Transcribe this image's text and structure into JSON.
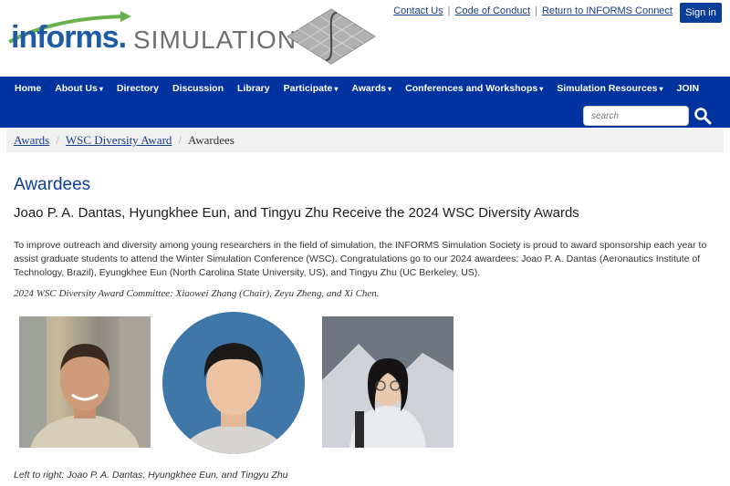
{
  "header": {
    "logo_informs": "informs.",
    "logo_simulation": "SIMULATION",
    "top_links": [
      "Contact Us",
      "Code of Conduct",
      "Return to INFORMS Connect"
    ],
    "signin_label": "Sign in"
  },
  "nav": {
    "items": [
      {
        "label": "Home",
        "caret": false
      },
      {
        "label": "About Us",
        "caret": true
      },
      {
        "label": "Directory",
        "caret": false
      },
      {
        "label": "Discussion",
        "caret": false
      },
      {
        "label": "Library",
        "caret": false
      },
      {
        "label": "Participate",
        "caret": true
      },
      {
        "label": "Awards",
        "caret": true
      },
      {
        "label": "Conferences and Workshops",
        "caret": true
      },
      {
        "label": "Simulation Resources",
        "caret": true
      },
      {
        "label": "JOIN",
        "caret": false
      }
    ],
    "search_placeholder": "search"
  },
  "breadcrumb": {
    "links": [
      "Awards",
      "WSC Diversity Award"
    ],
    "current": "Awardees"
  },
  "main": {
    "title": "Awardees",
    "headline": "Joao P. A. Dantas, Hyungkhee Eun, and Tingyu Zhu Receive the 2024 WSC Diversity Awards",
    "body": "To improve outreach and diversity among young researchers in the field of simulation, the INFORMS Simulation Society is proud to award sponsorship each year to assist graduate students to attend the Winter Simulation Conference (WSC). Congratulations go to our 2024 awardees: Joao P. A. Dantas (Aeronautics Institute of Technology, Brazil), Eyungkhee Eun (North Carolina State University, US), and Tingyu Zhu (UC Berkeley, US).",
    "committee": "2024 WSC Diversity Award Committee: Xiaowei Zhang (Chair), Zeyu Zheng, and Xi Chen.",
    "caption": "Left to right: Joao P. A. Dantas, Hyungkhee Eun, and Tingyu Zhu"
  },
  "colors": {
    "brand_blue": "#0033a0",
    "link_blue": "#1a3d8f",
    "title_blue": "#0a3e99"
  }
}
